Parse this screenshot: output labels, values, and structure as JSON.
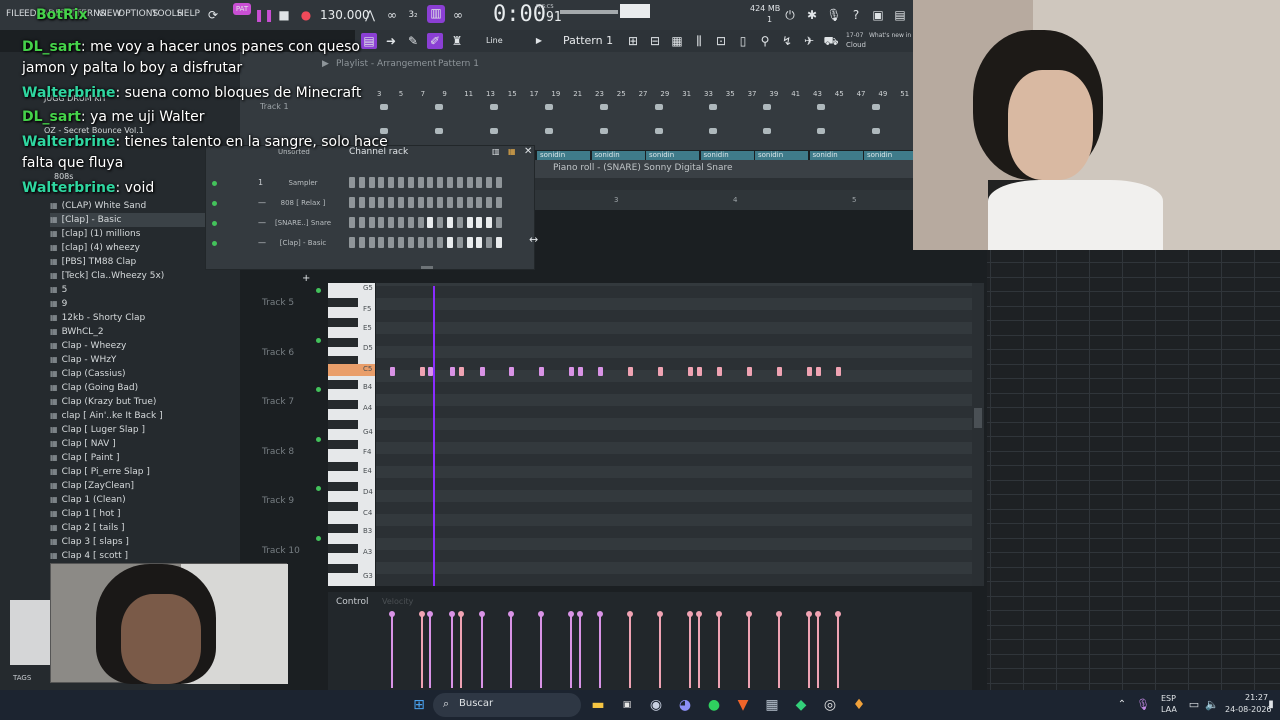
{
  "menu": {
    "file": "FILE",
    "edit": "EDIT",
    "add": "ADD",
    "patterns": "PATTERNS",
    "view": "VIEW",
    "options": "OPTIONS",
    "tools": "TOOLS",
    "help": "HELP"
  },
  "transport": {
    "time": "0:00",
    "time_small": "91",
    "time_unit": "M:S:CS",
    "tempo": "130.000",
    "memory": "424 MB",
    "cpu": "1",
    "pattern": "Pattern 1",
    "snap": "Line",
    "news_date": "17-07",
    "news": "What's new in",
    "cloud": "Cloud"
  },
  "playlist": {
    "title": "Playlist - Arrangement",
    "pattern": "Pattern 1",
    "track1": "Track 1",
    "ruler": [
      "3",
      "5",
      "7",
      "9",
      "11",
      "13",
      "15",
      "17",
      "19",
      "21",
      "23",
      "25",
      "27",
      "29",
      "31",
      "33",
      "35",
      "37",
      "39",
      "41",
      "43",
      "45",
      "47",
      "49",
      "51",
      "53"
    ],
    "clip_label": "sonidin"
  },
  "chat": [
    {
      "user": "BotRix",
      "text": ""
    },
    {
      "user": "DL_sart",
      "text": ": me voy a hacer unos panes con queso",
      "cont": "jamon y palta lo boy a disfrutar"
    },
    {
      "user": "Walterbrine",
      "text": ": suena como bloques de Minecraft"
    },
    {
      "user": "DL_sart",
      "text": ": ya me uji Walter"
    },
    {
      "user": "Walterbrine",
      "text": ": tienes talento en la sangre, solo hace",
      "cont": "falta que fluya"
    },
    {
      "user": "Walterbrine",
      "text": ": void"
    }
  ],
  "browser": {
    "top_items": [
      "JUGG DRUM KIT",
      "OZ - Secret Bounce Vol.1",
      "808s"
    ],
    "items": [
      "(CLAP) White Sand",
      "[Clap] - Basic",
      "[clap] (1) millions",
      "[clap] (4) wheezy",
      "[PBS] TM88 Clap",
      "[Teck] Cla..Wheezy 5x)",
      "5",
      "9",
      "12kb - Shorty Clap",
      "BWhCL_2",
      "Clap - Wheezy",
      "Clap - WHzY",
      "Clap (Cassius)",
      "Clap (Going Bad)",
      "Clap (Krazy but True)",
      "clap [ Ain'..ke It Back ]",
      "Clap [ Luger Slap ]",
      "Clap [ NAV ]",
      "Clap [ Paint ]",
      "Clap [ Pi_erre Slap ]",
      "Clap [ZayClean]",
      "Clap 1 (Clean)",
      "Clap 1 [ hot ]",
      "Clap 2 [ tails ]",
      "Clap 3 [ slaps ]",
      "Clap 4 [ scott ]"
    ],
    "tags": "TAGS"
  },
  "channel_rack": {
    "title": "Channel rack",
    "filter": "Unsorted",
    "channels": [
      {
        "num": "1",
        "name": "Sampler"
      },
      {
        "num": "—",
        "name": "808 [ Relax ]"
      },
      {
        "num": "—",
        "name": "[SNARE..] Snare"
      },
      {
        "num": "—",
        "name": "[Clap] - Basic"
      }
    ],
    "add": "+"
  },
  "piano_roll": {
    "title": "Piano roll - (SNARE) Sonny Digital Snare",
    "ruler": [
      "3",
      "4",
      "5"
    ],
    "keys": [
      "G5",
      "F5",
      "E5",
      "D5",
      "C5",
      "B4",
      "A4",
      "G4",
      "F4",
      "E4",
      "D4",
      "C4",
      "B3",
      "A3",
      "G3"
    ],
    "tracks": [
      "Track 5",
      "Track 6",
      "Track 7",
      "Track 8",
      "Track 9",
      "Track 10"
    ],
    "control_label": "Control",
    "control_param": "Velocity"
  },
  "taskbar": {
    "search": "Buscar",
    "lang": "ESP",
    "region": "LAA",
    "time": "21:27",
    "date": "24-08-2026"
  }
}
